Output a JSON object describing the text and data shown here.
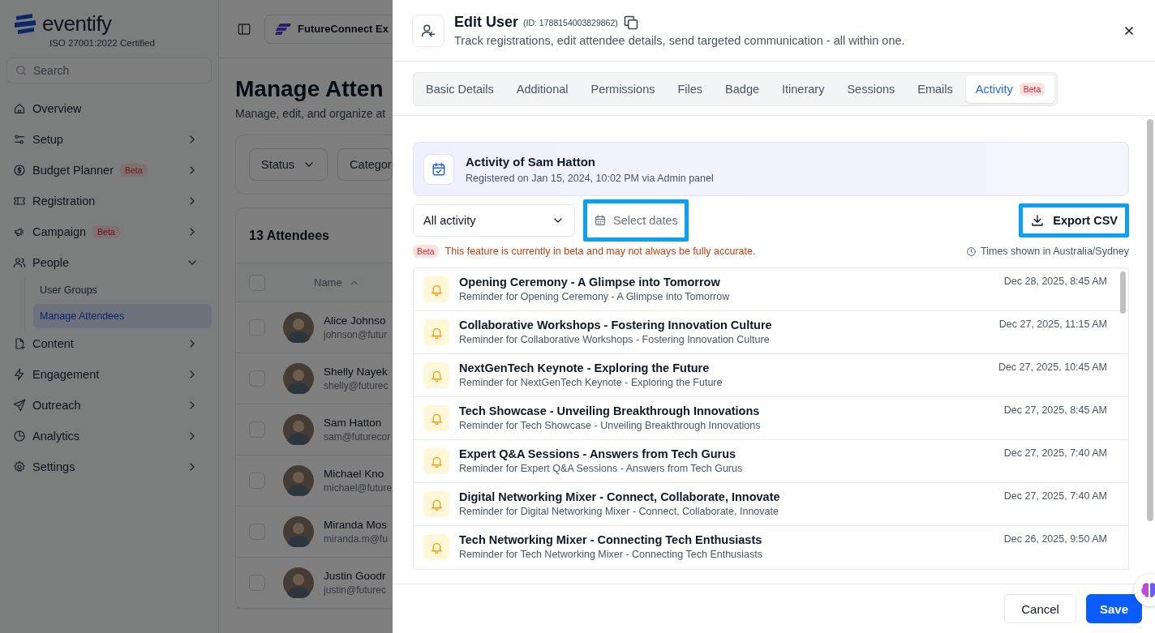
{
  "sidebar": {
    "logo": "eventify",
    "certification": "ISO 27001:2022 Certified",
    "search": {
      "placeholder": "Search"
    },
    "items": [
      {
        "label": "Overview"
      },
      {
        "label": "Setup",
        "expanded": false
      },
      {
        "label": "Budget Planner",
        "badge": "Beta",
        "expanded": false
      },
      {
        "label": "Registration",
        "expanded": false
      },
      {
        "label": "Campaign",
        "badge": "Beta",
        "expanded": false
      },
      {
        "label": "People",
        "expanded": true,
        "children": [
          {
            "label": "User Groups",
            "selected": false
          },
          {
            "label": "Manage Attendees",
            "selected": true
          }
        ]
      },
      {
        "label": "Content",
        "expanded": false
      },
      {
        "label": "Engagement",
        "expanded": false
      },
      {
        "label": "Outreach",
        "expanded": false
      },
      {
        "label": "Analytics",
        "expanded": false
      },
      {
        "label": "Settings",
        "expanded": false
      }
    ]
  },
  "page": {
    "event_selector": "FutureConnect Ex",
    "title": "Manage Atten",
    "subtitle": "Manage, edit, and organize at",
    "filters": [
      {
        "label": "Status",
        "caret": true
      },
      {
        "label": "Categor",
        "caret": false
      }
    ],
    "attendee_count": "13 Attendees",
    "name_column": "Name",
    "select_all_checked": false,
    "rows": [
      {
        "name": "Alice Johnso",
        "email": "johnson@futur",
        "checked": false
      },
      {
        "name": "Shelly Nayek",
        "email": "shelly@futurec",
        "checked": false
      },
      {
        "name": "Sam Hatton",
        "email": "sam@futurecor",
        "checked": false
      },
      {
        "name": "Michael Kno",
        "email": "michael@future",
        "checked": false
      },
      {
        "name": "Miranda Mos",
        "email": "miranda.m@fu",
        "checked": false
      },
      {
        "name": "Justin Goodr",
        "email": "justin@futurec",
        "checked": false
      }
    ]
  },
  "drawer": {
    "title": "Edit User",
    "id_label": "(ID: 1788154003829862)",
    "subtitle": "Track registrations, edit attendee details, send targeted communication - all within one.",
    "tabs": [
      {
        "label": "Basic Details",
        "selected": false
      },
      {
        "label": "Additional",
        "selected": false
      },
      {
        "label": "Permissions",
        "selected": false
      },
      {
        "label": "Files",
        "selected": false
      },
      {
        "label": "Badge",
        "selected": false
      },
      {
        "label": "Itinerary",
        "selected": false
      },
      {
        "label": "Sessions",
        "selected": false
      },
      {
        "label": "Emails",
        "selected": false
      },
      {
        "label": "Activity",
        "badge": "Beta",
        "selected": true
      }
    ],
    "activity": {
      "title": "Activity of Sam Hatton",
      "registered": "Registered on Jan 15, 2024, 10:02 PM via Admin panel"
    },
    "activity_filter": "All activity",
    "date_picker": {
      "placeholder": "Select dates",
      "highlighted": true
    },
    "export_button": {
      "label": "Export CSV",
      "highlighted": true
    },
    "beta_badge": "Beta",
    "beta_note": "This feature is currently in beta and may not always be fully accurate.",
    "timezone_note": "Times shown in Australia/Sydney",
    "events": [
      {
        "title": "Opening Ceremony - A Glimpse into Tomorrow",
        "detail": "Reminder for Opening Ceremony - A Glimpse into Tomorrow",
        "time": "Dec 28, 2025, 8:45 AM"
      },
      {
        "title": "Collaborative Workshops - Fostering Innovation Culture",
        "detail": "Reminder for Collaborative Workshops - Fostering Innovation Culture",
        "time": "Dec 27, 2025, 11:15 AM"
      },
      {
        "title": "NextGenTech Keynote - Exploring the Future",
        "detail": "Reminder for NextGenTech Keynote - Exploring the Future",
        "time": "Dec 27, 2025, 10:45 AM"
      },
      {
        "title": "Tech Showcase - Unveiling Breakthrough Innovations",
        "detail": "Reminder for Tech Showcase - Unveiling Breakthrough Innovations",
        "time": "Dec 27, 2025, 8:45 AM"
      },
      {
        "title": "Expert Q&A Sessions - Answers from Tech Gurus",
        "detail": "Reminder for Expert Q&A Sessions - Answers from Tech Gurus",
        "time": "Dec 27, 2025, 7:40 AM"
      },
      {
        "title": "Digital Networking Mixer - Connect, Collaborate, Innovate",
        "detail": "Reminder for Digital Networking Mixer - Connect, Collaborate, Innovate",
        "time": "Dec 27, 2025, 7:40 AM"
      },
      {
        "title": "Tech Networking Mixer - Connecting Tech Enthusiasts",
        "detail": "Reminder for Tech Networking Mixer - Connecting Tech Enthusiasts",
        "time": "Dec 26, 2025, 9:50 AM"
      }
    ],
    "cancel": "Cancel",
    "save": "Save"
  }
}
